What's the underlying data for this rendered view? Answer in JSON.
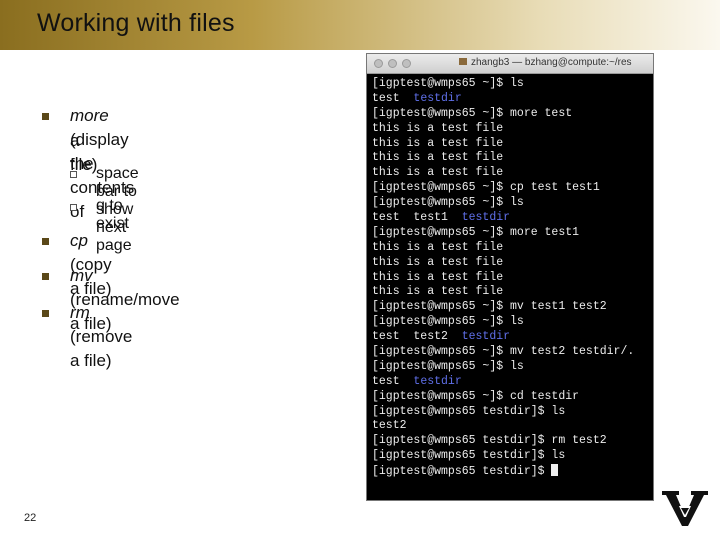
{
  "slide": {
    "title": "Working with files",
    "page_number": "22",
    "bullets": [
      {
        "cmd": "more",
        "desc": " (display the contents of",
        "desc2": "a file)"
      },
      {
        "cmd": "cp",
        "desc": " (copy a file)"
      },
      {
        "cmd": "mv",
        "desc": " (rename/move a file)"
      },
      {
        "cmd": "rm",
        "desc": " (remove a file)"
      }
    ],
    "sub_bullets": [
      "space bar to show next page",
      "q to exist"
    ]
  },
  "terminal": {
    "window_title": "zhangb3 — bzhang@compute:~/res",
    "lines": [
      "[igptest@wmps65 ~]$ ls",
      "test  testdir",
      "[igptest@wmps65 ~]$ more test",
      "this is a test file",
      "this is a test file",
      "this is a test file",
      "this is a test file",
      "[igptest@wmps65 ~]$ cp test test1",
      "[igptest@wmps65 ~]$ ls",
      "test  test1  testdir",
      "[igptest@wmps65 ~]$ more test1",
      "this is a test file",
      "this is a test file",
      "this is a test file",
      "this is a test file",
      "[igptest@wmps65 ~]$ mv test1 test2",
      "[igptest@wmps65 ~]$ ls",
      "test  test2  testdir",
      "[igptest@wmps65 ~]$ mv test2 testdir/.",
      "[igptest@wmps65 ~]$ ls",
      "test  testdir",
      "[igptest@wmps65 ~]$ cd testdir",
      "[igptest@wmps65 testdir]$ ls",
      "test2",
      "[igptest@wmps65 testdir]$ rm test2",
      "[igptest@wmps65 testdir]$ ls",
      "[igptest@wmps65 testdir]$ "
    ],
    "line_1": {
      "a": "test  ",
      "b": "testdir"
    },
    "line_9": {
      "a": "test  test1  ",
      "b": "testdir"
    },
    "line_17": {
      "a": "test  test2  ",
      "b": "testdir"
    },
    "line_20": {
      "a": "test  ",
      "b": "testdir"
    }
  },
  "colors": {
    "title_gold": "#8a6e1f",
    "bullet": "#5a4818",
    "dir_blue": "#5f6fe8"
  }
}
